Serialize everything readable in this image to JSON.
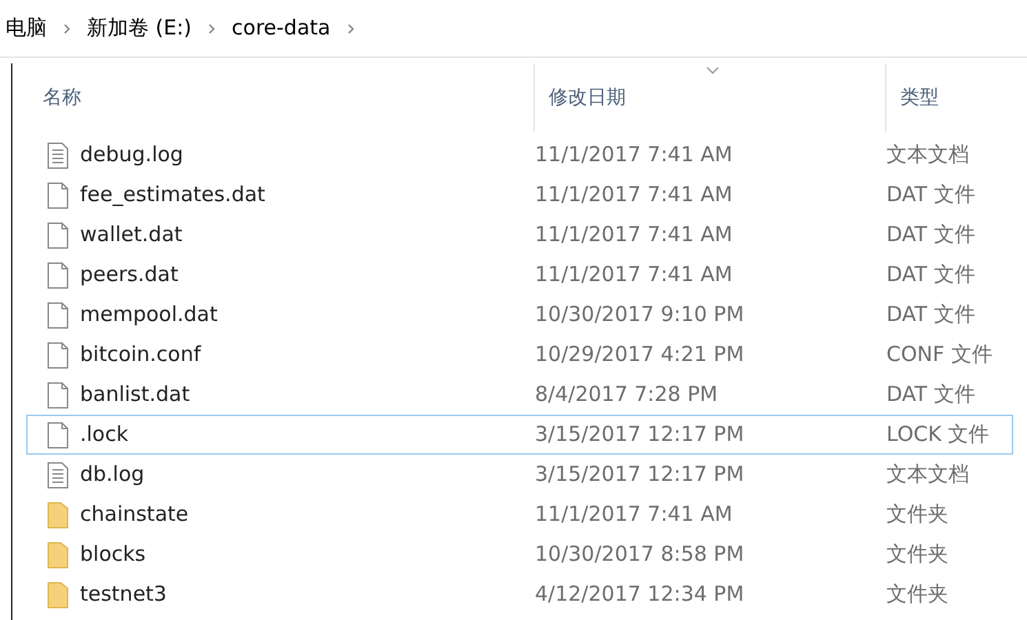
{
  "breadcrumb": [
    "电脑",
    "新加卷 (E:)",
    "core-data"
  ],
  "columns": [
    "名称",
    "修改日期",
    "类型"
  ],
  "rows": [
    {
      "kind": "text",
      "name": "debug.log",
      "date": "11/1/2017 7:41 AM",
      "type": "文本文档",
      "focused": false
    },
    {
      "kind": "file",
      "name": "fee_estimates.dat",
      "date": "11/1/2017 7:41 AM",
      "type": "DAT 文件",
      "focused": false
    },
    {
      "kind": "file",
      "name": "wallet.dat",
      "date": "11/1/2017 7:41 AM",
      "type": "DAT 文件",
      "focused": false
    },
    {
      "kind": "file",
      "name": "peers.dat",
      "date": "11/1/2017 7:41 AM",
      "type": "DAT 文件",
      "focused": false
    },
    {
      "kind": "file",
      "name": "mempool.dat",
      "date": "10/30/2017 9:10 PM",
      "type": "DAT 文件",
      "focused": false
    },
    {
      "kind": "file",
      "name": "bitcoin.conf",
      "date": "10/29/2017 4:21 PM",
      "type": "CONF 文件",
      "focused": false
    },
    {
      "kind": "file",
      "name": "banlist.dat",
      "date": "8/4/2017 7:28 PM",
      "type": "DAT 文件",
      "focused": false
    },
    {
      "kind": "file",
      "name": ".lock",
      "date": "3/15/2017 12:17 PM",
      "type": "LOCK 文件",
      "focused": true
    },
    {
      "kind": "text",
      "name": "db.log",
      "date": "3/15/2017 12:17 PM",
      "type": "文本文档",
      "focused": false
    },
    {
      "kind": "folder",
      "name": "chainstate",
      "date": "11/1/2017 7:41 AM",
      "type": "文件夹",
      "focused": false
    },
    {
      "kind": "folder",
      "name": "blocks",
      "date": "10/30/2017 8:58 PM",
      "type": "文件夹",
      "focused": false
    },
    {
      "kind": "folder",
      "name": "testnet3",
      "date": "4/12/2017 12:34 PM",
      "type": "文件夹",
      "focused": false
    }
  ]
}
